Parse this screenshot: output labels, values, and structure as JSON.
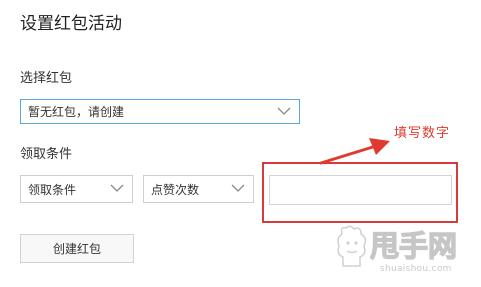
{
  "page": {
    "title": "设置红包活动"
  },
  "redpacket": {
    "label": "选择红包",
    "select_value": "暂无红包，请创建"
  },
  "condition": {
    "label": "领取条件",
    "type_select_value": "领取条件",
    "metric_select_value": "点赞次数",
    "number_input_value": ""
  },
  "actions": {
    "create_label": "创建红包"
  },
  "annotation": {
    "text": "填写数字",
    "color": "#e03a2e"
  },
  "watermark": {
    "brand": "甩手网",
    "url": "shuaishou.com"
  },
  "icons": {
    "select_chevron": "chevron-down-icon",
    "annotation_arrow": "arrow-icon"
  }
}
